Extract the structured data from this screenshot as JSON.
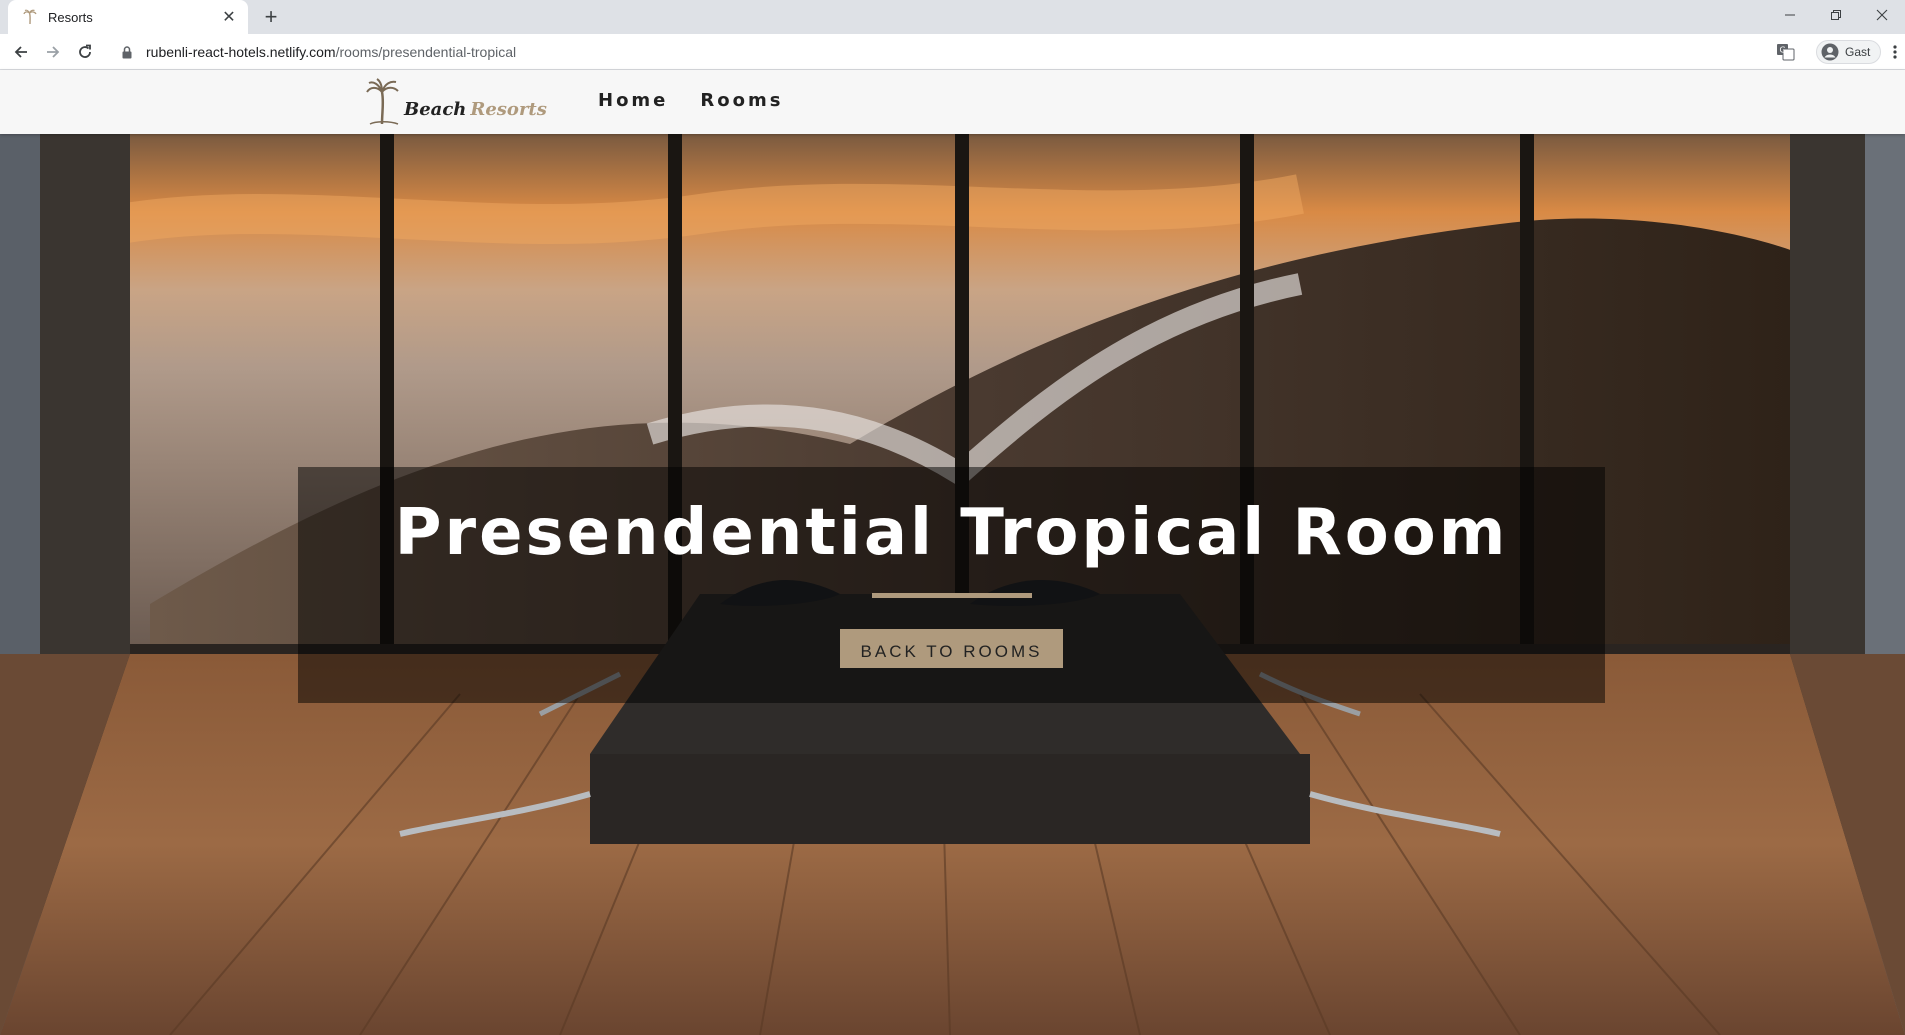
{
  "browser": {
    "tab_title": "Resorts",
    "new_tab_label": "+",
    "url_domain": "rubenli-react-hotels.netlify.com",
    "url_path": "/rooms/presendential-tropical",
    "profile_label": "Gast"
  },
  "site": {
    "logo_word1": "Beach",
    "logo_word2": "Resorts",
    "nav": {
      "home": "Home",
      "rooms": "Rooms"
    }
  },
  "hero": {
    "title": "Presendential Tropical Room",
    "button_label": "BACK TO ROOMS"
  },
  "colors": {
    "accent": "#af9a7d",
    "nav_text": "#222222",
    "nav_bg": "#f7f7f7",
    "banner_overlay": "rgba(0,0,0,0.5)"
  },
  "icons": [
    "palm-tree-icon",
    "close-icon",
    "back-arrow-icon",
    "forward-arrow-icon",
    "reload-icon",
    "lock-icon",
    "translate-icon",
    "profile-icon",
    "menu-dots-icon",
    "minimize-icon",
    "maximize-icon"
  ]
}
